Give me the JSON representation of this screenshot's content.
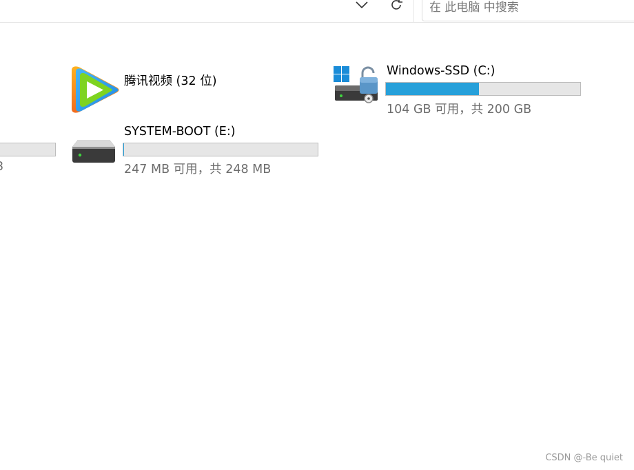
{
  "toolbar": {
    "search_placeholder": "在 此电脑 中搜索"
  },
  "drives": [
    {
      "name": "腾讯视频 (32 位)"
    },
    {
      "name": "Windows-SSD (C:)",
      "space_label": "104 GB 可用，共 200 GB",
      "used_fraction": 0.48
    },
    {
      "name": "SYSTEM-BOOT (E:)",
      "space_label": "247 MB 可用，共 248 MB",
      "used_fraction": 0.004
    },
    {
      "partial_label": "3",
      "used_fraction": 0.0
    }
  ],
  "watermark": "CSDN @-Be quiet",
  "colors": {
    "bar_fill": "#26a0da",
    "bar_track": "#e6e6e6",
    "secondary_text": "#6d6d6d"
  }
}
